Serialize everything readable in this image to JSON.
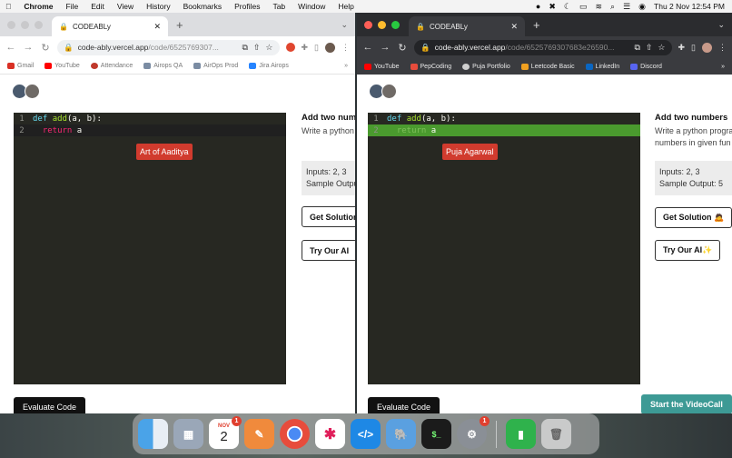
{
  "menubar": {
    "app": "Chrome",
    "items": [
      "File",
      "Edit",
      "View",
      "History",
      "Bookmarks",
      "Profiles",
      "Tab",
      "Window",
      "Help"
    ],
    "clock": "Thu 2 Nov  12:54 PM"
  },
  "left_window": {
    "tab_title": "CODEABLy",
    "url_main": "code-ably.vercel.app",
    "url_rest": "/code/6525769307...",
    "bookmarks": [
      "Gmail",
      "YouTube",
      "Attendance",
      "Airops QA",
      "AirOps Prod",
      "Jira Airops"
    ],
    "bookmarks_more": "»",
    "code_lines": [
      "1",
      "2"
    ],
    "cursor_label": "Art of Aaditya",
    "question_title": "Add two numb",
    "question_desc": "Write a python numbers in giv",
    "io_inputs": "Inputs: 2, 3",
    "io_output": "Sample Outpu",
    "btn_solution": "Get Solution",
    "btn_ai": "Try Our AI",
    "btn_evaluate": "Evaluate Code"
  },
  "right_window": {
    "tab_title": "CODEABLy",
    "url_main": "code-ably.vercel.app",
    "url_rest": "/code/6525769307683e26590...",
    "bookmarks": [
      "YouTube",
      "PepCoding",
      "Puja Portfolio",
      "Leetcode Basic",
      "LinkedIn",
      "Discord"
    ],
    "bookmarks_more": "»",
    "code_lines": [
      "1",
      "2"
    ],
    "cursor_label": "Puja Agarwal",
    "question_title": "Add two numbers",
    "question_desc": "Write a python progra numbers in given fun",
    "io_inputs": "Inputs: 2, 3",
    "io_output": "Sample Output: 5",
    "btn_solution": "Get Solution 🙇",
    "btn_ai": "Try Our AI✨",
    "btn_evaluate": "Evaluate Code",
    "btn_videocall": "Start the VideoCall"
  },
  "dock": {
    "calendar_month": "NOV",
    "calendar_day": "2",
    "badges": [
      "1",
      "1"
    ],
    "apps": [
      "finder-icon",
      "launchpad-icon",
      "calendar-icon",
      "pen-icon",
      "chrome-icon",
      "slack-icon",
      "vscode-icon",
      "tableplus-icon",
      "terminal-icon",
      "settings-icon",
      "numbers-icon",
      "trash-icon"
    ]
  },
  "colors": {
    "editor_bg": "#272822",
    "cursor_red": "#d13b2e",
    "highlight_green": "#4a9a2e",
    "teal": "#3d9a95"
  }
}
